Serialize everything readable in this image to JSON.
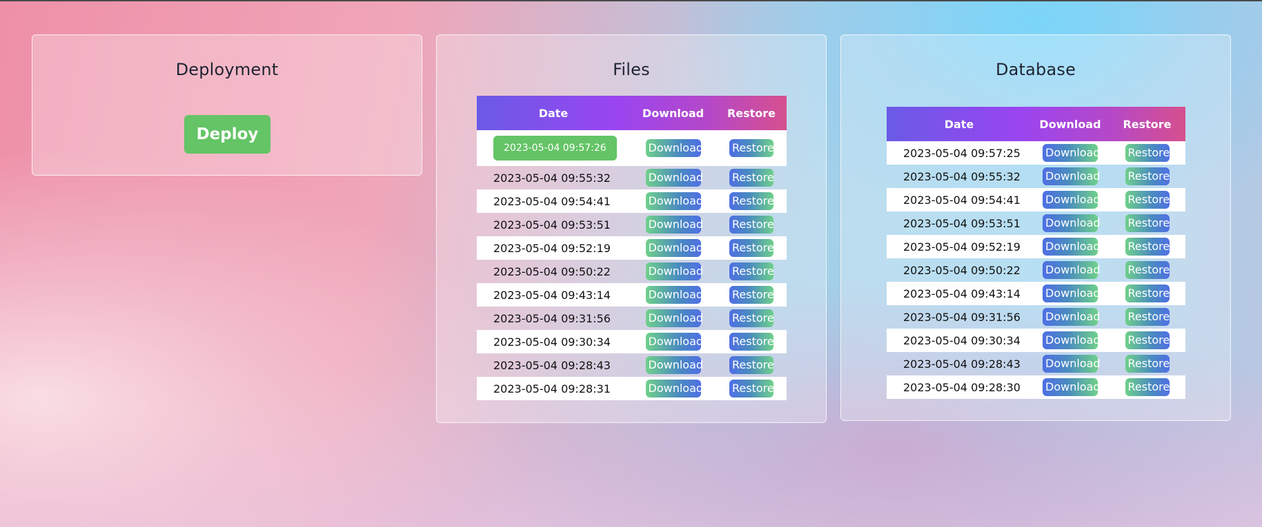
{
  "colors": {
    "deploy_button": "#64c466",
    "header_gradient": [
      "#6a5ae6",
      "#9a45f0",
      "#d6508e"
    ],
    "button_green": "#6fd08a",
    "button_blue": "#4f6fe4"
  },
  "deployment": {
    "title": "Deployment",
    "deploy_label": "Deploy"
  },
  "files": {
    "title": "Files",
    "columns": [
      "Date",
      "Download",
      "Restore"
    ],
    "download_label": "Download",
    "restore_label": "Restore",
    "rows": [
      {
        "date": "2023-05-04 09:57:26",
        "highlighted": true
      },
      {
        "date": "2023-05-04 09:55:32"
      },
      {
        "date": "2023-05-04 09:54:41"
      },
      {
        "date": "2023-05-04 09:53:51"
      },
      {
        "date": "2023-05-04 09:52:19"
      },
      {
        "date": "2023-05-04 09:50:22"
      },
      {
        "date": "2023-05-04 09:43:14"
      },
      {
        "date": "2023-05-04 09:31:56"
      },
      {
        "date": "2023-05-04 09:30:34"
      },
      {
        "date": "2023-05-04 09:28:43"
      },
      {
        "date": "2023-05-04 09:28:31"
      }
    ]
  },
  "database": {
    "title": "Database",
    "columns": [
      "Date",
      "Download",
      "Restore"
    ],
    "download_label": "Download",
    "restore_label": "Restore",
    "rows": [
      {
        "date": "2023-05-04 09:57:25"
      },
      {
        "date": "2023-05-04 09:55:32"
      },
      {
        "date": "2023-05-04 09:54:41"
      },
      {
        "date": "2023-05-04 09:53:51"
      },
      {
        "date": "2023-05-04 09:52:19"
      },
      {
        "date": "2023-05-04 09:50:22"
      },
      {
        "date": "2023-05-04 09:43:14"
      },
      {
        "date": "2023-05-04 09:31:56"
      },
      {
        "date": "2023-05-04 09:30:34"
      },
      {
        "date": "2023-05-04 09:28:43"
      },
      {
        "date": "2023-05-04 09:28:30"
      }
    ]
  }
}
